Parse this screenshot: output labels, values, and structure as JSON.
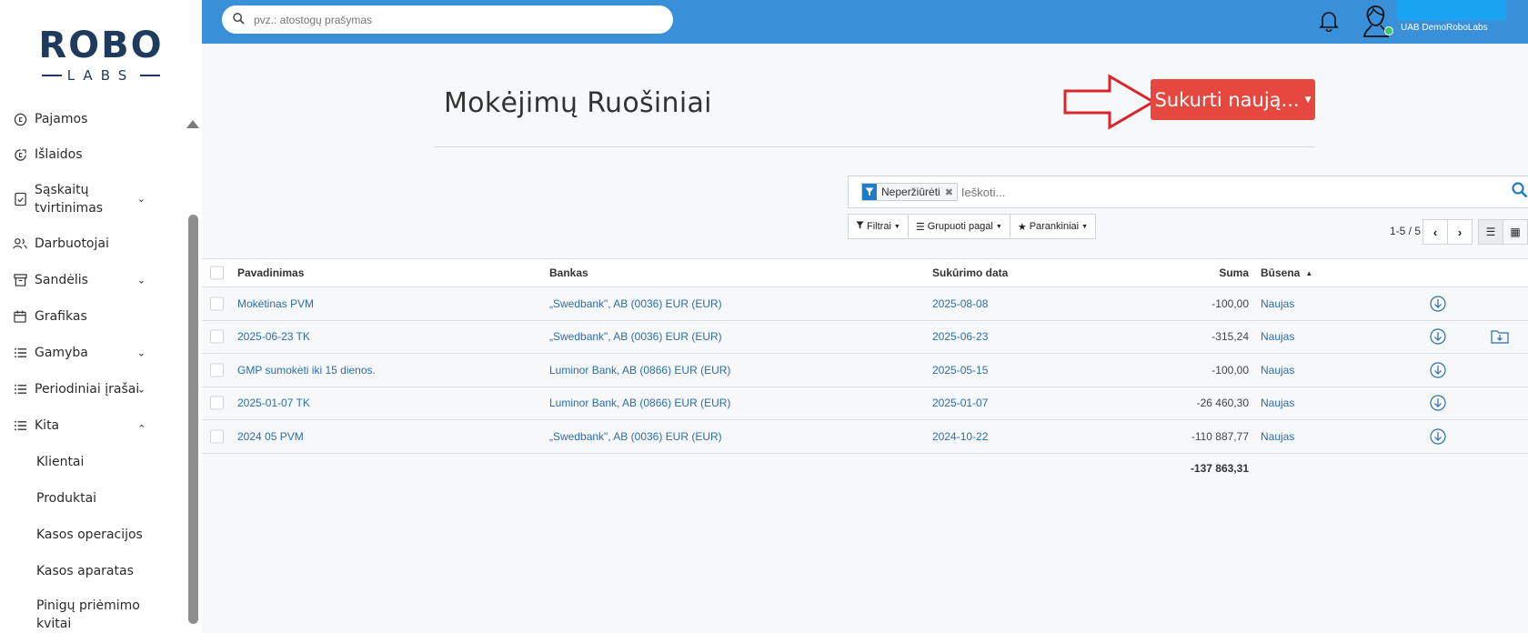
{
  "logo": {
    "top": "ROBO",
    "bottom": "LABS"
  },
  "sidebar": {
    "items": [
      {
        "label": "Pajamos",
        "icon": "coin-icon"
      },
      {
        "label": "Išlaidos",
        "icon": "coin-out-icon"
      },
      {
        "label": "Sąskaitų tvirtinimas",
        "icon": "invoice-check-icon",
        "expandable": true
      },
      {
        "label": "Darbuotojai",
        "icon": "users-icon"
      },
      {
        "label": "Sandėlis",
        "icon": "archive-icon",
        "expandable": true
      },
      {
        "label": "Grafikas",
        "icon": "calendar-icon"
      },
      {
        "label": "Gamyba",
        "icon": "list-icon",
        "expandable": true
      },
      {
        "label": "Periodiniai įrašai",
        "icon": "list-icon",
        "expandable": true
      },
      {
        "label": "Kita",
        "icon": "list-icon",
        "expanded": true
      }
    ],
    "sub_items": [
      "Klientai",
      "Produktai",
      "Kasos operacijos",
      "Kasos aparatas",
      "Pinigų priėmimo kvitai"
    ]
  },
  "topbar": {
    "search_placeholder": "pvz.: atostogų prašymas",
    "company": "UAB DemoRoboLabs"
  },
  "main": {
    "title": "Mokėjimų Ruošiniai",
    "create_button": "Sukurti naują...",
    "search": {
      "facet": "Neperžiūrėti",
      "placeholder": "Ieškoti..."
    },
    "filters": [
      "Filtrai",
      "Grupuoti pagal",
      "Parankiniai"
    ],
    "pager": "1-5 / 5"
  },
  "table": {
    "columns": {
      "name": "Pavadinimas",
      "bank": "Bankas",
      "date": "Sukūrimo data",
      "sum": "Suma",
      "status": "Būsena"
    },
    "rows": [
      {
        "name": "Mokėtinas PVM",
        "bank": "„Swedbank\", AB (0036) EUR (EUR)",
        "date": "2025-08-08",
        "sum": "-100,00",
        "status": "Naujas"
      },
      {
        "name": "2025-06-23 TK",
        "bank": "„Swedbank\", AB (0036) EUR (EUR)",
        "date": "2025-06-23",
        "sum": "-315,24",
        "status": "Naujas"
      },
      {
        "name": "GMP sumokėti iki 15 dienos.",
        "bank": "Luminor Bank, AB (0866) EUR (EUR)",
        "date": "2025-05-15",
        "sum": "-100,00",
        "status": "Naujas"
      },
      {
        "name": "2025-01-07 TK",
        "bank": "Luminor Bank, AB (0866) EUR (EUR)",
        "date": "2025-01-07",
        "sum": "-26 460,30",
        "status": "Naujas"
      },
      {
        "name": "2024 05 PVM",
        "bank": "„Swedbank\", AB (0036) EUR (EUR)",
        "date": "2024-10-22",
        "sum": "-110 887,77",
        "status": "Naujas"
      }
    ],
    "total": "-137 863,31"
  },
  "colors": {
    "topbar": "#3a8fd9",
    "create_button": "#e6483f",
    "link": "#2b6ea9",
    "annotation_arrow": "#d9262c"
  }
}
